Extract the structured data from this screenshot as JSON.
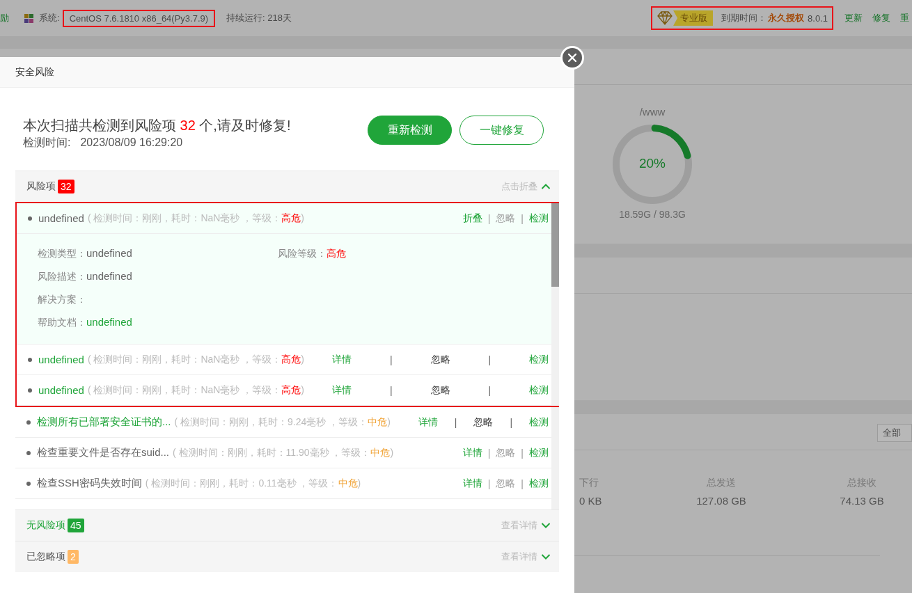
{
  "background_page": {
    "header": {
      "cut_link": "励",
      "system_label": "系统:",
      "system_value": "CentOS 7.6.1810 x86_64(Py3.7.9)",
      "system_highlighted": true,
      "uptime": "持续运行: 218天",
      "edition": "专业版",
      "expiry_label": "到期时间：",
      "expiry_value": "永久授权",
      "version": "8.0.1",
      "license_highlighted": true,
      "links": [
        "更新",
        "修复",
        "重"
      ]
    },
    "disk": {
      "path": "/www",
      "percent": "20%",
      "level": 0.2,
      "usage": "18.59G / 98.3G"
    },
    "network": {
      "filter": "全部",
      "stats": [
        {
          "label": "下行",
          "value": "0 KB"
        },
        {
          "label": "总发送",
          "value": "127.08 GB"
        },
        {
          "label": "总接收",
          "value": "74.13 GB"
        }
      ]
    }
  },
  "dialog": {
    "title": "安全风险",
    "summary": {
      "prefix": "本次扫描共检测到风险项 ",
      "count": "32",
      "suffix": " 个,请及时修复!"
    },
    "scan_time_label": "检测时间:",
    "scan_time": "2023/08/09 16:29:20",
    "buttons": [
      {
        "label": "重新检测",
        "kind": "primary"
      },
      {
        "label": "一键修复",
        "kind": "outline"
      }
    ],
    "risk_section": {
      "title": "风险项",
      "badge": "32",
      "color": "#ff0000",
      "title_highlighted": false,
      "toggle": "点击折叠",
      "expanded": true
    },
    "items": [
      {
        "name": "undefined",
        "meta": "( 检测时间：刚刚，耗时：NaN毫秒 ，等级：",
        "grade": "高危",
        "color": "#ff0000",
        "meta_end": ")",
        "kind": "plain",
        "highlighted": true,
        "actions": [
          "折叠",
          "忽略",
          "检测"
        ],
        "separators": [
          "|",
          "|"
        ],
        "details": [
          [
            {
              "label": "检测类型：",
              "value": "undefined",
              "kind": "text"
            },
            {
              "label": "风险等级：",
              "value": "高危",
              "kind": "danger"
            }
          ],
          [
            {
              "label": "风险描述：",
              "value": "undefined",
              "kind": "text"
            }
          ],
          [
            {
              "label": "解决方案："
            }
          ],
          [
            {
              "label": "帮助文档：",
              "value": "undefined",
              "kind": "link"
            }
          ]
        ]
      },
      {
        "name": "undefined",
        "meta": "( 检测时间：刚刚，耗时：NaN毫秒 ，等级：",
        "grade": "高危",
        "color": "#ff0000",
        "meta_end": ")",
        "kind": "linked",
        "highlighted": true,
        "actions": [
          "详情",
          "忽略",
          "检测"
        ],
        "separators": [
          "|",
          "|"
        ]
      },
      {
        "name": "undefined",
        "meta": "( 检测时间：刚刚，耗时：NaN毫秒 ，等级：",
        "grade": "高危",
        "color": "#ff0000",
        "meta_end": ")",
        "kind": "linked",
        "highlighted": true,
        "actions": [
          "详情",
          "忽略",
          "检测"
        ],
        "separators": [
          "|",
          "|"
        ]
      },
      {
        "name": "检测所有已部署安全证书的...",
        "meta": "( 检测时间：刚刚，耗时：9.24毫秒 ，等级：",
        "grade": "中危",
        "color": "#f0a030",
        "meta_end": ")",
        "kind": "linked",
        "highlighted": false,
        "actions": [
          "详情",
          "忽略",
          "检测"
        ],
        "separators": [
          "|",
          "|"
        ]
      },
      {
        "name": "检查重要文件是否存在suid...",
        "meta": "( 检测时间：刚刚，耗时：11.90毫秒 ，等级：",
        "grade": "中危",
        "color": "#f0a030",
        "meta_end": ")",
        "kind": "plain",
        "highlighted": false,
        "actions": [
          "详情",
          "忽略",
          "检测"
        ],
        "separators": [
          "|",
          "|"
        ]
      },
      {
        "name": "检查SSH密码失效时间",
        "meta": "( 检测时间：刚刚，耗时：0.11毫秒 ，等级：",
        "grade": "中危",
        "color": "#f0a030",
        "meta_end": ")",
        "kind": "plain",
        "highlighted": false,
        "actions": [
          "详情",
          "忽略",
          "检测"
        ],
        "separators": [
          "|",
          "|"
        ]
      }
    ],
    "other_sections": [
      {
        "title": "无风险项",
        "badge": "45",
        "color": "#20a53a",
        "title_highlighted": true,
        "toggle": "查看详情",
        "expanded": false
      },
      {
        "title": "已忽略项",
        "badge": "2",
        "color": "#ffb865",
        "title_highlighted": false,
        "toggle": "查看详情",
        "expanded": false
      }
    ]
  }
}
